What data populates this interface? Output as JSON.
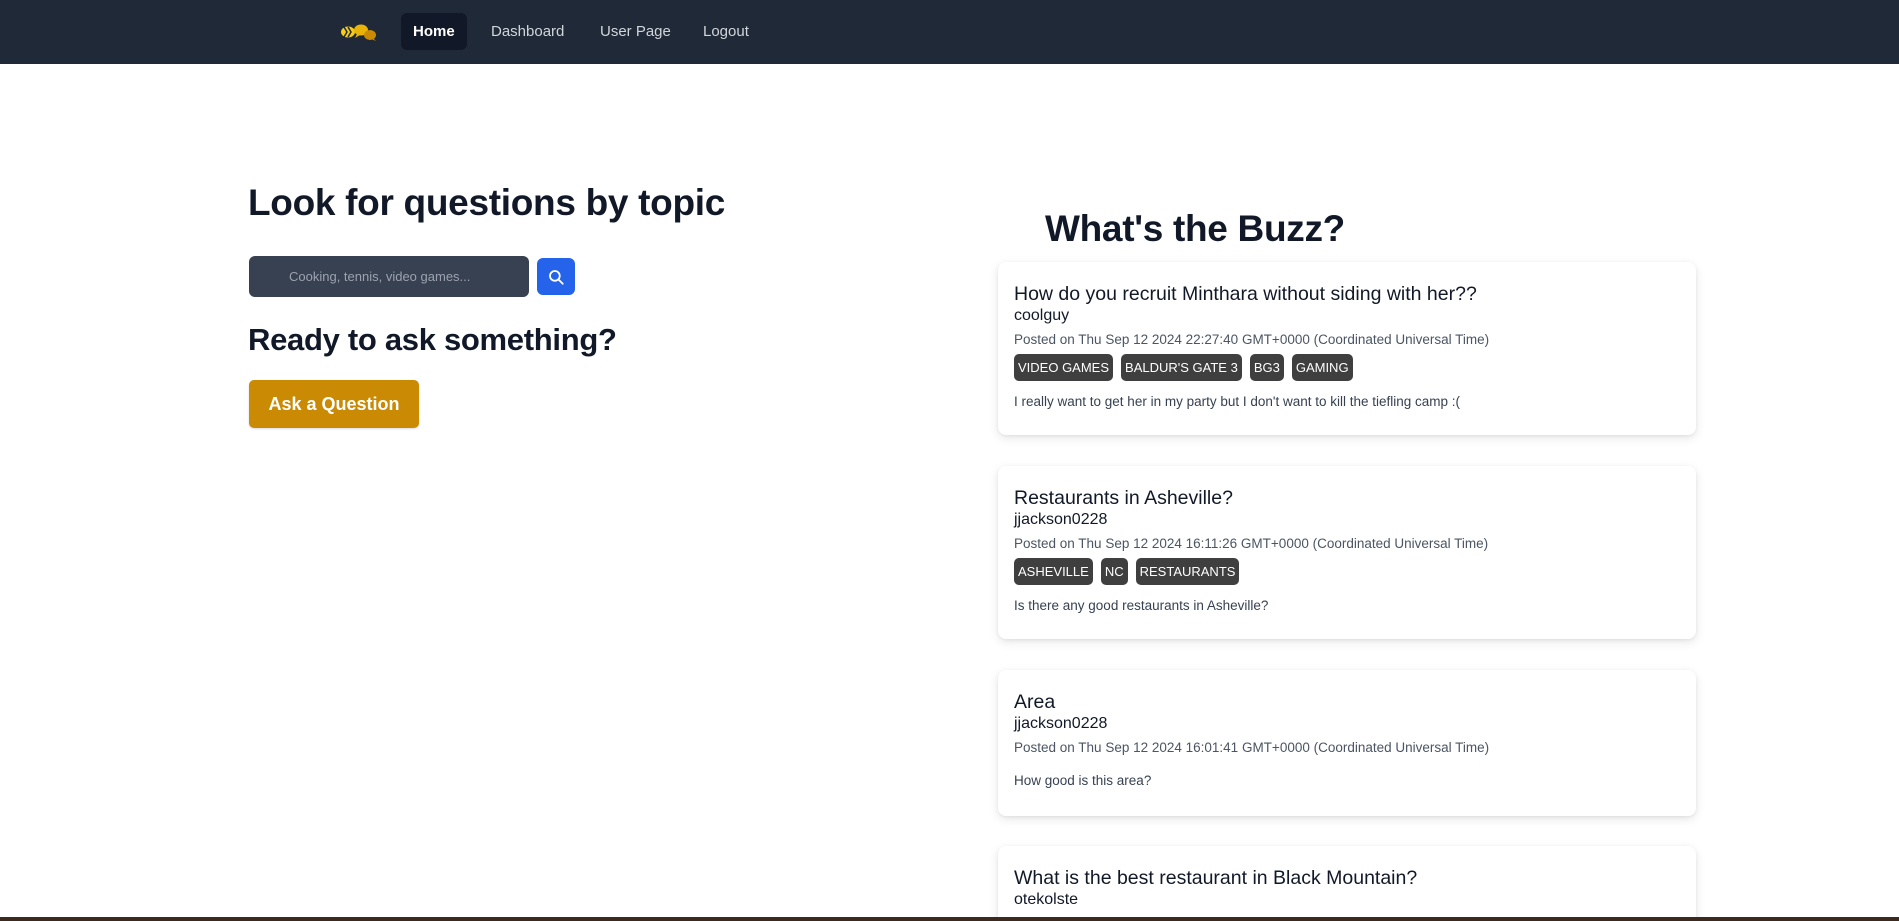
{
  "nav": {
    "links": [
      {
        "label": "Home",
        "active": true
      },
      {
        "label": "Dashboard",
        "active": false
      },
      {
        "label": "User Page",
        "active": false
      },
      {
        "label": "Logout",
        "active": false
      }
    ]
  },
  "search_section": {
    "title": "Look for questions by topic",
    "placeholder": "Cooking, tennis, video games...",
    "button_icon": "search-icon"
  },
  "ask_section": {
    "title": "Ready to ask something?",
    "button_label": "Ask a Question"
  },
  "buzz": {
    "title": "What's the Buzz?",
    "questions": [
      {
        "title": "How do you recruit Minthara without siding with her??",
        "author": "coolguy",
        "posted": "Posted on Thu Sep 12 2024 22:27:40 GMT+0000 (Coordinated Universal Time)",
        "tags": [
          "VIDEO GAMES",
          "BALDUR'S GATE 3",
          "BG3",
          "GAMING"
        ],
        "body": "I really want to get her in my party but I don't want to kill the tiefling camp :("
      },
      {
        "title": "Restaurants in Asheville?",
        "author": "jjackson0228",
        "posted": "Posted on Thu Sep 12 2024 16:11:26 GMT+0000 (Coordinated Universal Time)",
        "tags": [
          "ASHEVILLE",
          "NC",
          "RESTAURANTS"
        ],
        "body": "Is there any good restaurants in Asheville?"
      },
      {
        "title": "Area",
        "author": "jjackson0228",
        "posted": "Posted on Thu Sep 12 2024 16:01:41 GMT+0000 (Coordinated Universal Time)",
        "tags": [],
        "body": "How good is this area?"
      },
      {
        "title": "What is the best restaurant in Black Mountain?",
        "author": "otekolste"
      }
    ]
  },
  "colors": {
    "navbar": "#1f2937",
    "accent_yellow": "#ca8a04",
    "search_button": "#2563eb",
    "tag_bg": "#3f3f3f"
  }
}
